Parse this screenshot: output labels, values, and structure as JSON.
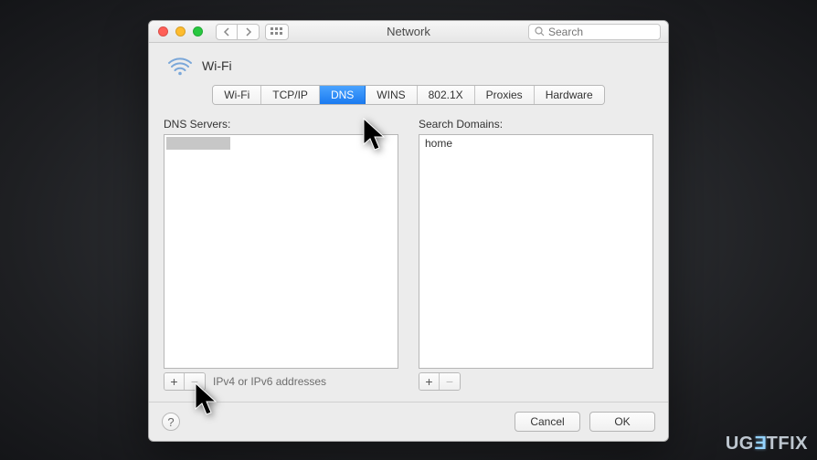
{
  "window": {
    "title": "Network",
    "search_placeholder": "Search"
  },
  "interface": {
    "name": "Wi-Fi"
  },
  "tabs": {
    "items": [
      {
        "label": "Wi-Fi"
      },
      {
        "label": "TCP/IP"
      },
      {
        "label": "DNS"
      },
      {
        "label": "WINS"
      },
      {
        "label": "802.1X"
      },
      {
        "label": "Proxies"
      },
      {
        "label": "Hardware"
      }
    ],
    "active_index": 2
  },
  "panes": {
    "dns_servers": {
      "label": "DNS Servers:",
      "items": [
        ""
      ],
      "footer_hint": "IPv4 or IPv6 addresses",
      "add_label": "+",
      "remove_label": "−"
    },
    "search_domains": {
      "label": "Search Domains:",
      "items": [
        "home"
      ],
      "add_label": "+",
      "remove_label": "−"
    }
  },
  "footer": {
    "help_label": "?",
    "cancel_label": "Cancel",
    "ok_label": "OK"
  },
  "watermark": {
    "text_left": "UG",
    "text_mid": "E",
    "text_right": "TFIX"
  }
}
